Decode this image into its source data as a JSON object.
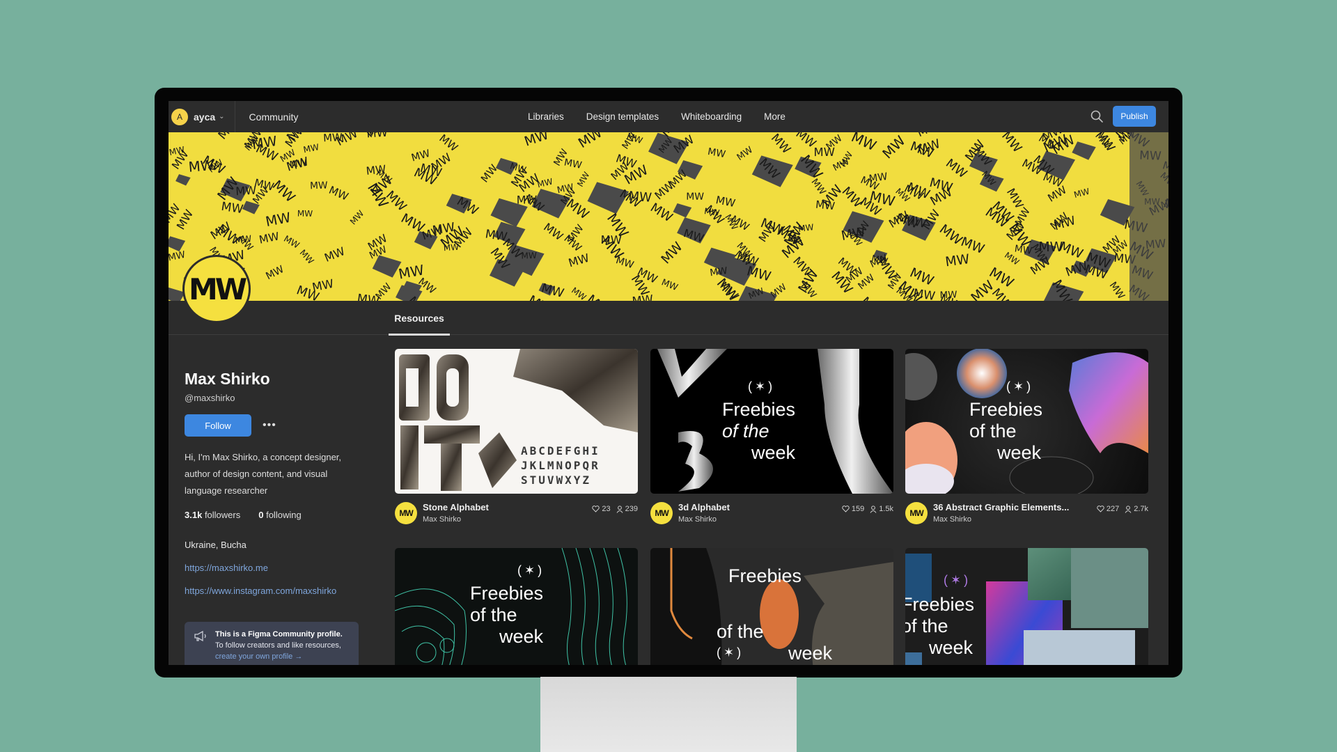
{
  "nav": {
    "user_initial": "A",
    "user_name": "ayca",
    "community_label": "Community",
    "links": [
      "Libraries",
      "Design templates",
      "Whiteboarding",
      "More"
    ],
    "publish_label": "Publish"
  },
  "profile": {
    "avatar_text": "MW",
    "name": "Max Shirko",
    "handle": "@maxshirko",
    "follow_label": "Follow",
    "more_label": "•••",
    "bio": "Hi, I'm Max Shirko, a concept designer, author of design content, and visual language researcher",
    "followers_count": "3.1k",
    "followers_label": "followers",
    "following_count": "0",
    "following_label": "following",
    "location": "Ukraine, Bucha",
    "links": [
      "https://maxshirko.me",
      "https://www.instagram.com/maxshirko"
    ],
    "notice": {
      "title": "This is a Figma Community profile.",
      "body": "To follow creators and like resources,",
      "cta": "create your own profile →"
    }
  },
  "tabs": {
    "active": "Resources"
  },
  "colors": {
    "accent": "#3d87e0",
    "brand_yellow": "#f5e03f",
    "background": "#2c2c2c",
    "link": "#7fa6dc"
  },
  "resources": [
    {
      "title": "Stone Alphabet",
      "author": "Max Shirko",
      "likes": "23",
      "users": "239",
      "art": "stone",
      "thumb_text": "ABCDEFGHI JKLMNOPQR STUVWXYZ",
      "big_text": "DO IT"
    },
    {
      "title": "3d Alphabet",
      "author": "Max Shirko",
      "likes": "159",
      "users": "1.5k",
      "art": "silver"
    },
    {
      "title": "36 Abstract Graphic Elements...",
      "author": "Max Shirko",
      "likes": "227",
      "users": "2.7k",
      "art": "abstract"
    },
    {
      "art": "skull"
    },
    {
      "art": "mask"
    },
    {
      "art": "crystal"
    }
  ],
  "thumb_text": {
    "star": "(✶)",
    "line1": "Freebies",
    "line2": "of the",
    "line3": "week",
    "badge": "MW"
  }
}
